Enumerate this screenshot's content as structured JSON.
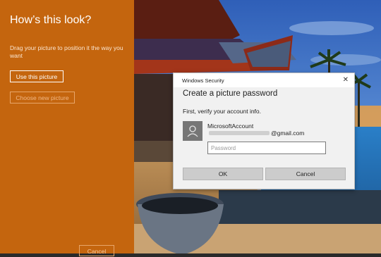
{
  "left_panel": {
    "title": "How’s this look?",
    "instructions": "Drag your picture to position it the way you want",
    "use_button": "Use this picture",
    "choose_button": "Choose new picture",
    "cancel_button": "Cancel",
    "bg_color": "#c4650e"
  },
  "dialog": {
    "window_title": "Windows Security",
    "close_glyph": "✕",
    "heading": "Create a picture password",
    "subtext": "First, verify your account info.",
    "account_name": "MicrosoftAccount",
    "account_email": "@gmail.com",
    "password_placeholder": "Password",
    "ok_button": "OK",
    "cancel_button": "Cancel"
  }
}
